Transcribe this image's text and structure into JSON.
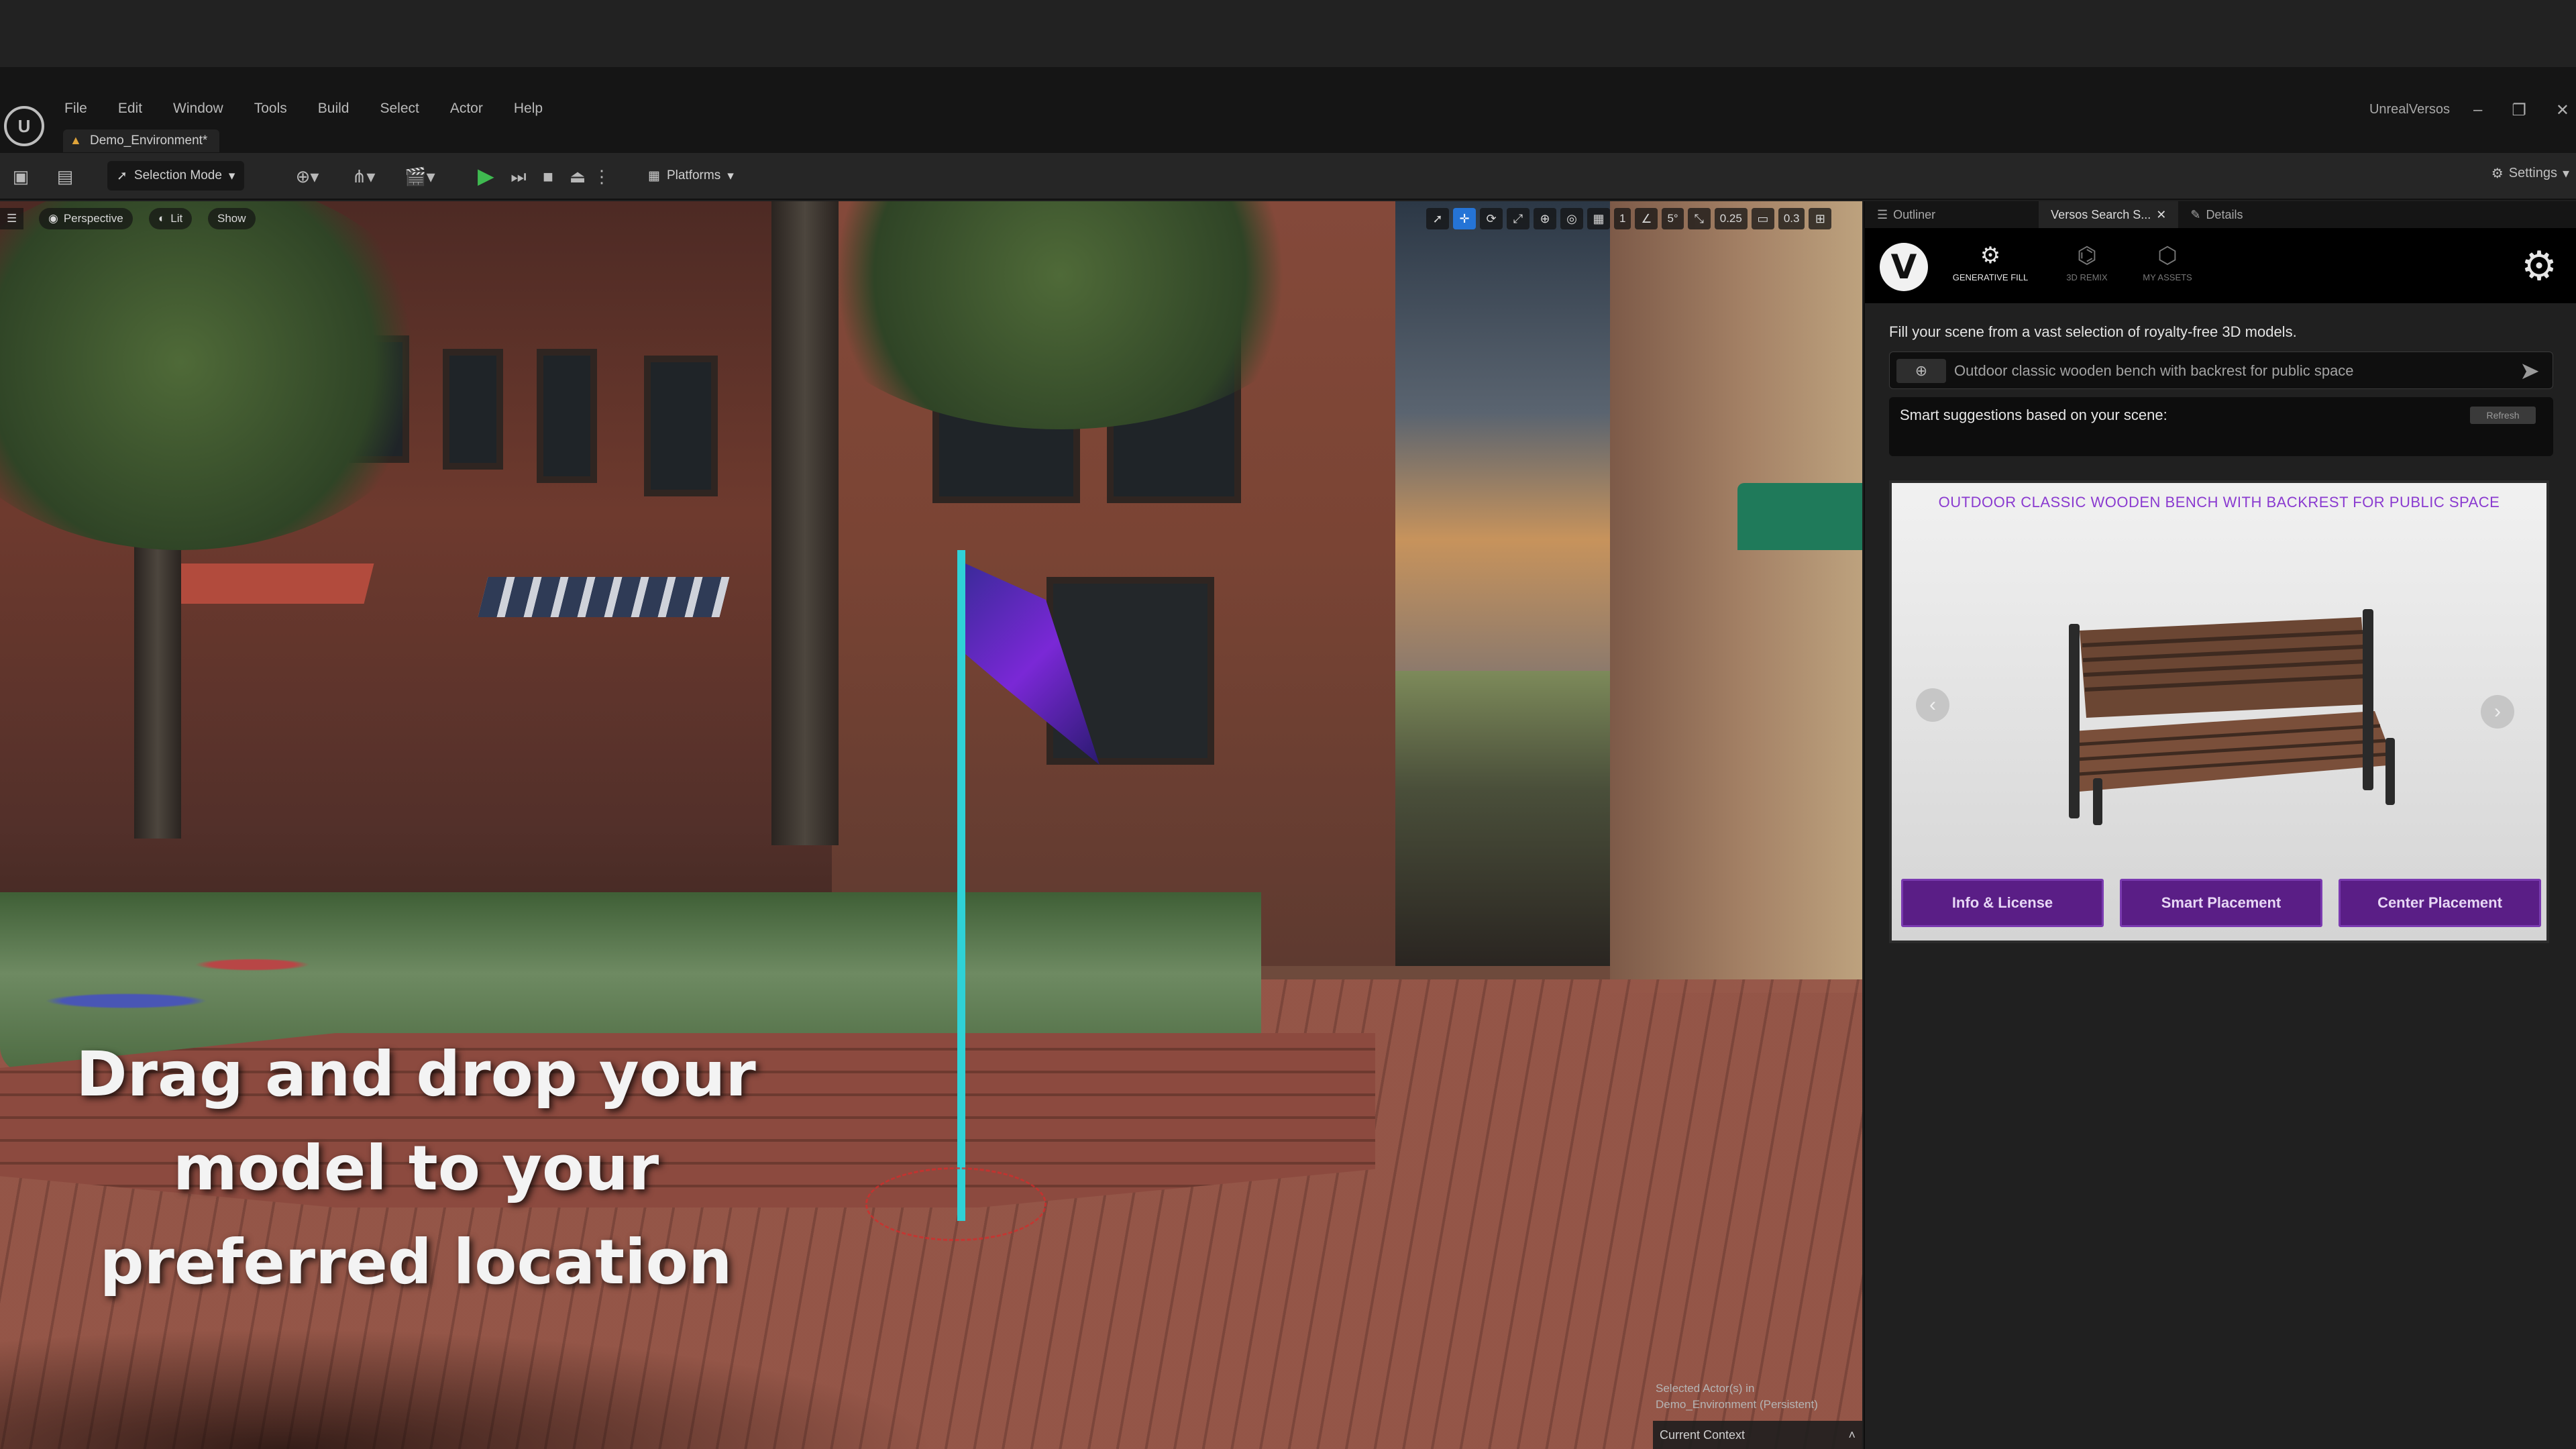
{
  "menu": [
    "File",
    "Edit",
    "Window",
    "Tools",
    "Build",
    "Select",
    "Actor",
    "Help"
  ],
  "doc_tab": "Demo_Environment*",
  "app_name": "UnrealVersos",
  "window_controls": [
    "–",
    "❐",
    "✕"
  ],
  "toolbar": {
    "selection_mode": "Selection Mode",
    "platforms": "Platforms",
    "settings": "Settings"
  },
  "viewport": {
    "perspective": "Perspective",
    "lit": "Lit",
    "show": "Show",
    "grid_value": "1",
    "angle_value": "5°",
    "scale_value": "0.25",
    "camera_speed": "0.3",
    "caption": "Drag and drop your model to your preferred location",
    "selected_actors": "Selected Actor(s) in",
    "selected_level": "Demo_Environment (Persistent)",
    "current_context": "Current Context"
  },
  "panel": {
    "tabs": [
      "Outliner",
      "Versos Search S...",
      "Details"
    ],
    "nav": [
      "GENERATIVE FILL",
      "3D REMIX",
      "MY ASSETS"
    ],
    "description": "Fill your scene from a vast selection of royalty-free 3D models.",
    "search_value": "Outdoor classic wooden bench with backrest for public space",
    "suggestions_label": "Smart suggestions based on your scene:",
    "refresh": "Refresh",
    "card_title": "OUTDOOR CLASSIC WOODEN BENCH WITH BACKREST FOR PUBLIC SPACE",
    "buttons": [
      "Info & License",
      "Smart Placement",
      "Center Placement"
    ]
  },
  "colors": {
    "accent_purple": "#5a1e86",
    "card_title_purple": "#8a3ad0",
    "flag_pole": "#2fd1d6",
    "play_green": "#3fb950",
    "tool_active_blue": "#2574d6"
  }
}
